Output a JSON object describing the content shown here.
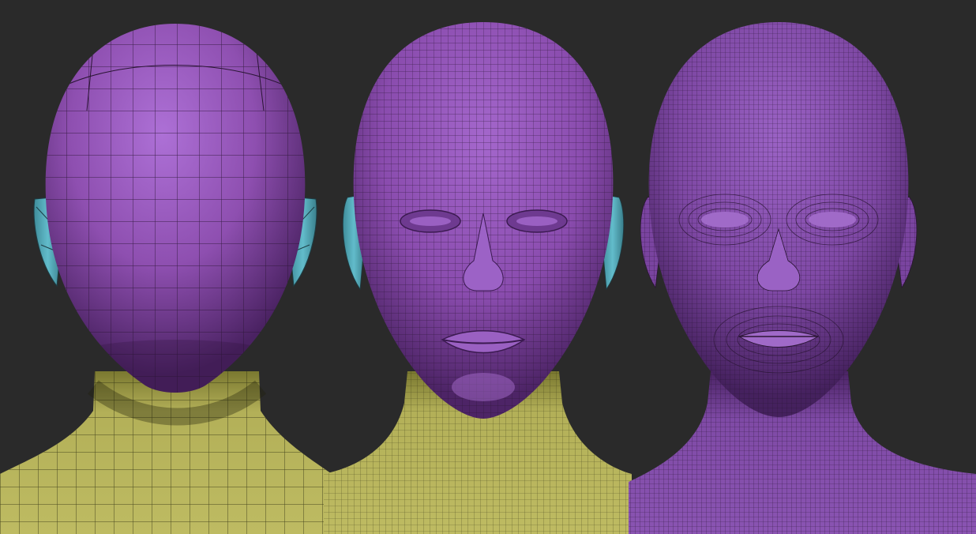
{
  "scene": {
    "background": "#2a2a2a",
    "colors": {
      "head_purple": "#8e4fb0",
      "head_purple_light": "#a86ad0",
      "head_purple_dark": "#4f2568",
      "neck_yellow": "#b7b45a",
      "neck_yellow_dark": "#6f6d2b",
      "ear_cyan": "#5ab4c4",
      "wire": "#2a1534"
    },
    "models": [
      {
        "name": "low-poly-head-back-view",
        "topology": "low",
        "view": "back",
        "has_ears": true,
        "neck_color": "yellow"
      },
      {
        "name": "mid-poly-head-front-view",
        "topology": "mid",
        "view": "front",
        "has_ears": true,
        "neck_color": "yellow"
      },
      {
        "name": "high-poly-head-front-view",
        "topology": "high",
        "view": "front",
        "has_ears": true,
        "neck_color": "purple"
      }
    ]
  }
}
